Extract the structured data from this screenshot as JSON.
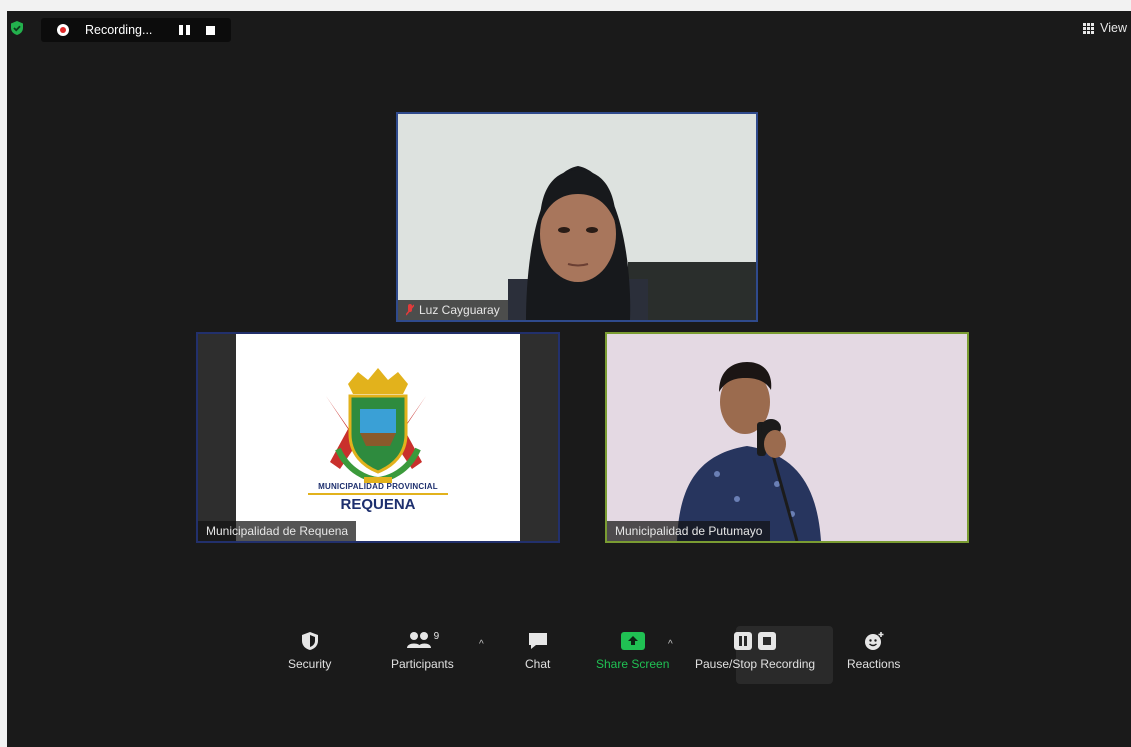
{
  "topbar": {
    "recording_label": "Recording...",
    "view_label": "View"
  },
  "participants": [
    {
      "name": "Luz Cayguaray",
      "muted": true
    },
    {
      "name": "Municipalidad de Requena",
      "muted": false
    },
    {
      "name": "Municipalidad de Putumayo",
      "muted": false
    }
  ],
  "requena_logo": {
    "line1": "MUNICIPALIDAD PROVINCIAL",
    "line2": "REQUENA"
  },
  "toolbar": {
    "security": "Security",
    "participants": "Participants",
    "participants_count": "9",
    "chat": "Chat",
    "share_screen": "Share Screen",
    "recording": "Pause/Stop Recording",
    "reactions": "Reactions"
  },
  "colors": {
    "background": "#1a1a1a",
    "share_green": "#20c153",
    "active_speaker_border": "#7a9c32",
    "recording_red": "#e02828"
  }
}
